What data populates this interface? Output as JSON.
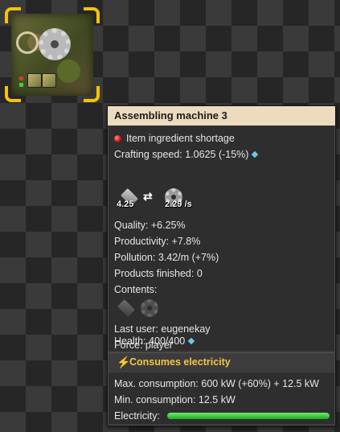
{
  "tooltip": {
    "title": "Assembling machine 3",
    "status": "Item ingredient shortage",
    "crafting_speed": "Crafting speed: 1.0625 (-15%)",
    "recipe": {
      "ingredient_icon": "iron-plate-icon",
      "ingredient_amount": "4.25",
      "product_icon": "iron-gear-wheel-icon",
      "product_rate": "2.29 /s"
    },
    "quality": "Quality: +6.25%",
    "productivity": "Productivity: +7.8%",
    "pollution": "Pollution: 3.42/m (+7%)",
    "products_finished": "Products finished: 0",
    "contents_label": "Contents:",
    "contents_icons": [
      "iron-plate-icon",
      "iron-gear-wheel-icon"
    ],
    "last_user": "Last user: eugenekay",
    "force": "Force: player",
    "health": "Health: 400/400"
  },
  "electricity": {
    "header": "Consumes electricity",
    "max_consumption": "Max. consumption: 600 kW (+60%) + 12.5 kW",
    "min_consumption": "Min. consumption: 12.5 kW",
    "electricity_label": "Electricity:",
    "level": 1.0
  },
  "colors": {
    "title_bg": "#eddbbf",
    "selection": "#f5c400",
    "electric_header": "#f6c445",
    "status_red": "#d01010",
    "bar_green": "#3fcf3f"
  }
}
